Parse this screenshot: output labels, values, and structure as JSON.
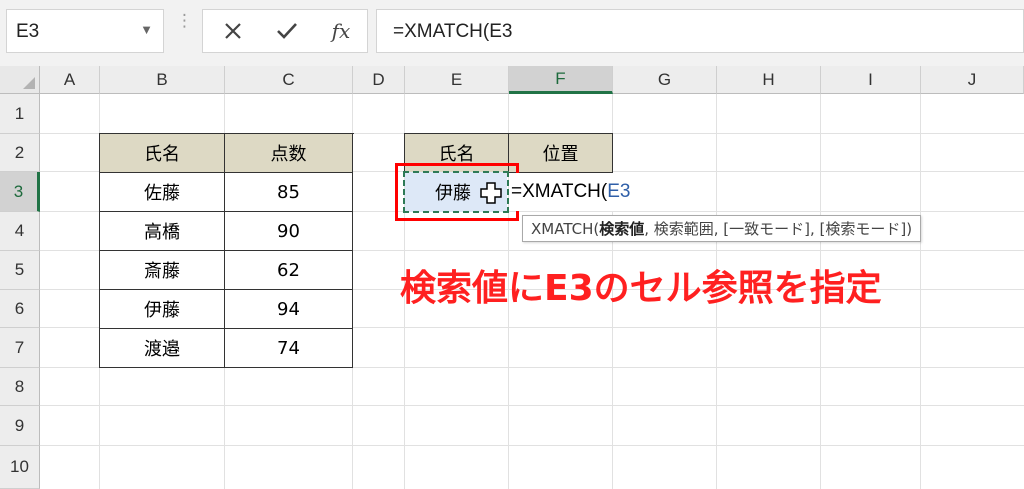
{
  "formula_bar": {
    "name_box": "E3",
    "cancel_icon": "x-icon",
    "enter_icon": "check-icon",
    "fx_label": "fx",
    "formula_text": "=XMATCH(E3"
  },
  "columns": [
    "A",
    "B",
    "C",
    "D",
    "E",
    "F",
    "G",
    "H",
    "I",
    "J"
  ],
  "rows": [
    "1",
    "2",
    "3",
    "4",
    "5",
    "6",
    "7",
    "8",
    "9",
    "10"
  ],
  "active_cell": {
    "column": "F",
    "row": "3"
  },
  "table1": {
    "headers": [
      "氏名",
      "点数"
    ],
    "rows": [
      [
        "佐藤",
        "85"
      ],
      [
        "高橋",
        "90"
      ],
      [
        "斎藤",
        "62"
      ],
      [
        "伊藤",
        "94"
      ],
      [
        "渡邉",
        "74"
      ]
    ]
  },
  "table2": {
    "headers": [
      "氏名",
      "位置"
    ],
    "e3_value": "伊藤",
    "f3_editing": {
      "prefix": "=XMATCH(",
      "ref": "E3"
    }
  },
  "tooltip": {
    "func": "XMATCH(",
    "current_arg": "検索値",
    "rest": ", 検索範囲, [一致モード], [検索モード])"
  },
  "annotation": "検索値にE3のセル参照を指定",
  "colors": {
    "header_fill": "#ddd9c4",
    "selected_fill": "#dde8f7",
    "excel_green": "#217346",
    "annotation_red": "#ff2020",
    "ref_blue": "#2f5fa8"
  }
}
